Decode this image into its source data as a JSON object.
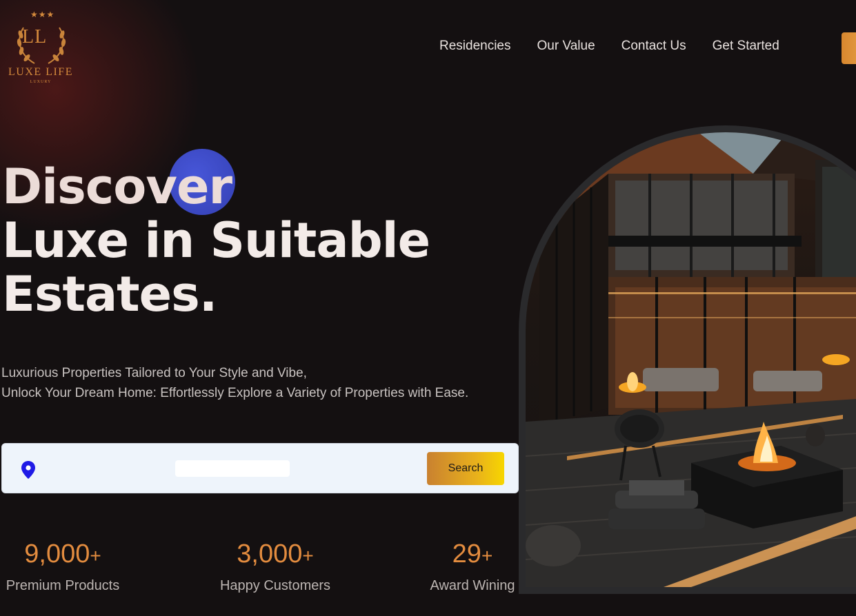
{
  "logo": {
    "stars": "★★★",
    "monogram": "LL",
    "name": "LUXE LIFE",
    "tagline": "LUXURY"
  },
  "nav": {
    "items": [
      "Residencies",
      "Our Value",
      "Contact Us",
      "Get Started"
    ]
  },
  "hero": {
    "title_line1": "Discover",
    "title_line2": "Luxe in Suitable",
    "title_line3": "Estates.",
    "desc_line1": "Luxurious Properties Tailored to Your Style and Vibe,",
    "desc_line2": "Unlock Your Dream Home: Effortlessly Explore a Variety of Properties with Ease."
  },
  "search": {
    "icon": "location-pin-icon",
    "value": "",
    "button_label": "Search"
  },
  "stats": [
    {
      "value": "9,000",
      "suffix": "+",
      "label": "Premium Products"
    },
    {
      "value": "3,000",
      "suffix": "+",
      "label": "Happy Customers"
    },
    {
      "value": "29",
      "suffix": "+",
      "label": "Award Wining"
    }
  ],
  "colors": {
    "background": "#141011",
    "accent": "#e38c3f",
    "blob": "#3f4bd0",
    "search_bg": "#eef4fb",
    "search_button_start": "#c98130",
    "search_button_end": "#f7d600"
  }
}
